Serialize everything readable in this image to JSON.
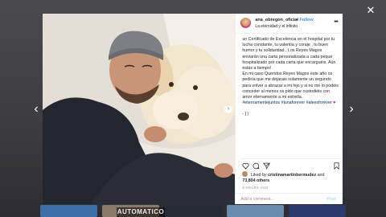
{
  "overlay": {
    "close_icon": "close-icon",
    "prev_icon": "chevron-left-icon",
    "next_icon": "chevron-right-icon",
    "background_label": "AUTOMATICO"
  },
  "post": {
    "username": "ana_obregon_oficial",
    "separator": "•",
    "follow_label": "Follow",
    "location": "La eternidad y el infinito",
    "caption_lines": [
      "un Certificado de Excelencia en el hospital por tu lucha constante, tu valentía y coraje , tu buen humor y tu solidaridad . Los Reyes Magos enviarán una carta personalizada a cada peque hospitalizado por cada carta que encarguéis. Aún estás a tiempo!",
      "En mi caso Queridos Reyes Magos este año os pediría que me dejarais solamente un segundo para volver a abrazar a mi hijo y si no me lo podéis conceder al menos os pido que custodiéis con amor eternamente a mi estrella."
    ],
    "hashtags": "#eternamentejuntos #lunaforever #aleesforever",
    "heart": "♥",
    "caption_end": "- ] )",
    "liked_by_prefix": "Liked by",
    "liked_by_user": "cristinamartinbermudez",
    "liked_by_suffix": "and",
    "others_count": "73,804 others",
    "time_ago": "3 HOURS AGO",
    "comment_placeholder": "Add a comment...",
    "post_label": "Post"
  },
  "colors": {
    "link_blue": "#3897f0",
    "heart_red": "#d6283b",
    "hashtag": "#003569"
  }
}
